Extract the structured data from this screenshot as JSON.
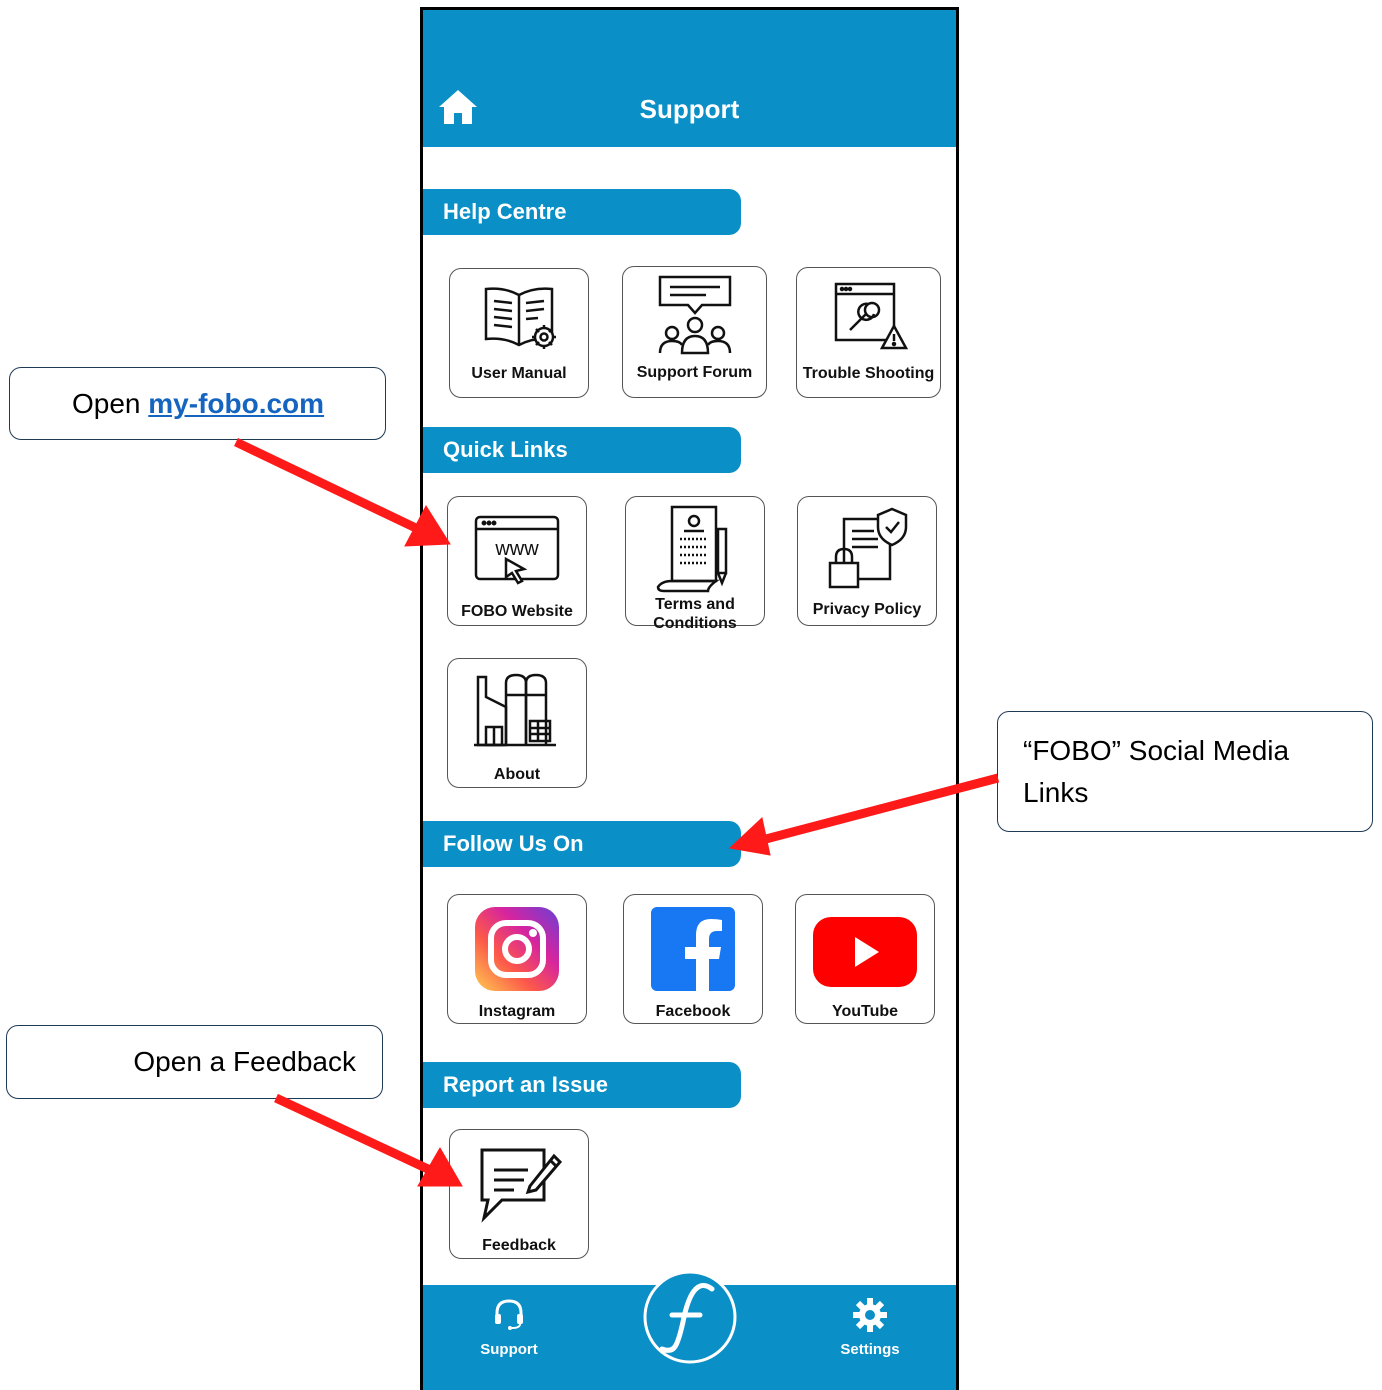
{
  "header": {
    "title": "Support"
  },
  "sections": {
    "help_centre": "Help Centre",
    "quick_links": "Quick Links",
    "follow_us": "Follow Us On",
    "report_issue": "Report an Issue"
  },
  "help_items": [
    {
      "label": "User Manual",
      "icon": "book-gear-icon"
    },
    {
      "label": "Support Forum",
      "icon": "forum-icon"
    },
    {
      "label": "Trouble Shooting",
      "icon": "troubleshoot-icon"
    }
  ],
  "quick_items": [
    {
      "label": "FOBO Website",
      "icon": "www-icon"
    },
    {
      "label": "Terms and Conditions",
      "icon": "document-pen-icon"
    },
    {
      "label": "Privacy Policy",
      "icon": "privacy-lock-icon"
    },
    {
      "label": "About",
      "icon": "factory-icon"
    }
  ],
  "social_items": [
    {
      "label": "Instagram",
      "icon": "instagram-icon"
    },
    {
      "label": "Facebook",
      "icon": "facebook-icon"
    },
    {
      "label": "YouTube",
      "icon": "youtube-icon"
    }
  ],
  "report_items": [
    {
      "label": "Feedback",
      "icon": "feedback-icon"
    }
  ],
  "bottom_nav": {
    "support": "Support",
    "settings": "Settings"
  },
  "callouts": {
    "website_prefix": "Open ",
    "website_link": "my-fobo.com",
    "social": "“FOBO” Social Media Links",
    "feedback": "Open a Feedback"
  },
  "colors": {
    "brand_blue": "#0a8fc6",
    "arrow_red": "#ff1a1a",
    "link_blue": "#1565c0"
  }
}
